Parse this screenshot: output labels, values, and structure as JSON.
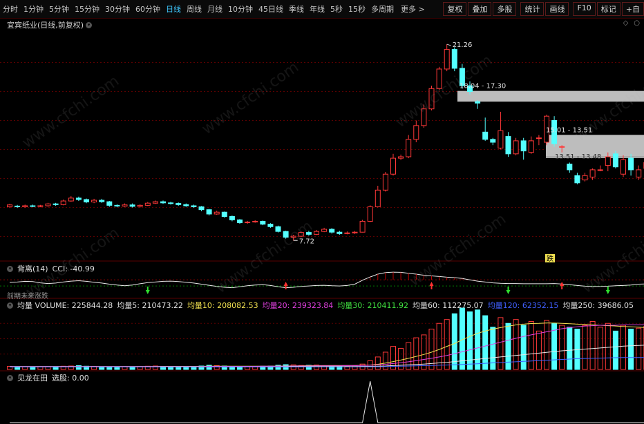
{
  "toolbar": {
    "timeframes": [
      "分时",
      "1分钟",
      "5分钟",
      "15分钟",
      "30分钟",
      "60分钟",
      "日线",
      "周线",
      "月线",
      "10分钟",
      "45日线",
      "季线",
      "年线",
      "5秒",
      "15秒",
      "多周期"
    ],
    "active_timeframe": "日线",
    "more_label": "更多 >",
    "right_buttons": [
      "复权",
      "叠加",
      "多股",
      "统计",
      "画线",
      "F10",
      "标记",
      "+自"
    ]
  },
  "chart_title": "宜宾纸业(日线,前复权)",
  "watermark": "www.cfchi.com",
  "main_annotations": {
    "high_label": "21.26",
    "low_label": "7.72",
    "box1_label": "18.04 - 17.30",
    "box2_label": "15.01 - 13.51",
    "box3_label": "13.51 - 13.48",
    "signal_label": "跌"
  },
  "cci_panel": {
    "name": "背离(14)",
    "value_text": "CCI: -40.99",
    "sublabel": "前期未来涨跌"
  },
  "volume_panel": {
    "items": [
      {
        "text": "均量  VOLUME: 225844.28",
        "color": "#e0e0e0"
      },
      {
        "text": "均量5: 210473.22",
        "color": "#e0e0e0"
      },
      {
        "text": "均量10: 208082.53",
        "color": "#f0e050"
      },
      {
        "text": "均量20: 239323.84",
        "color": "#e040e0"
      },
      {
        "text": "均量30: 210411.92",
        "color": "#40e040"
      },
      {
        "text": "均量60: 112275.07",
        "color": "#e0e0e0"
      },
      {
        "text": "均量120: 62352.15",
        "color": "#4060ff"
      },
      {
        "text": "均量250: 39686.05",
        "color": "#e0e0e0"
      }
    ]
  },
  "signal_panel": {
    "name": "见龙在田",
    "value_text": "选股: 0.00"
  },
  "colors": {
    "up": "#ff3838",
    "down": "#54ffff",
    "grid": "#5a0000",
    "box": "#bdbdbd"
  },
  "chart_data": [
    {
      "type": "candlestick",
      "title": "宜宾纸业(日线,前复权)",
      "ylim": [
        6.5,
        22.5
      ],
      "candles": [
        [
          10.05,
          10.18,
          10.25,
          9.98
        ],
        [
          10.1,
          10.05,
          10.18,
          9.98
        ],
        [
          10.05,
          10.12,
          10.2,
          9.98
        ],
        [
          10.12,
          10.1,
          10.2,
          10.02
        ],
        [
          10.1,
          10.12,
          10.18,
          10.02
        ],
        [
          10.12,
          10.25,
          10.32,
          10.05
        ],
        [
          10.25,
          10.2,
          10.32,
          10.12
        ],
        [
          10.2,
          10.45,
          10.55,
          10.15
        ],
        [
          10.45,
          10.65,
          10.78,
          10.4
        ],
        [
          10.65,
          10.55,
          10.75,
          10.45
        ],
        [
          10.55,
          10.38,
          10.62,
          10.3
        ],
        [
          10.38,
          10.5,
          10.6,
          10.3
        ],
        [
          10.5,
          10.4,
          10.6,
          10.32
        ],
        [
          10.4,
          10.15,
          10.45,
          10.05
        ],
        [
          10.15,
          10.1,
          10.22,
          10.02
        ],
        [
          10.1,
          10.18,
          10.28,
          10.05
        ],
        [
          10.18,
          10.08,
          10.28,
          10.0
        ],
        [
          10.08,
          10.15,
          10.22,
          10.0
        ],
        [
          10.15,
          10.3,
          10.38,
          10.1
        ],
        [
          10.3,
          10.4,
          10.48,
          10.25
        ],
        [
          10.4,
          10.32,
          10.48,
          10.25
        ],
        [
          10.32,
          10.28,
          10.4,
          10.2
        ],
        [
          10.28,
          10.2,
          10.35,
          10.12
        ],
        [
          10.2,
          10.12,
          10.28,
          10.05
        ],
        [
          10.12,
          10.05,
          10.2,
          9.98
        ],
        [
          10.05,
          9.85,
          10.1,
          9.75
        ],
        [
          9.85,
          9.55,
          9.9,
          9.45
        ],
        [
          9.55,
          9.68,
          9.78,
          9.5
        ],
        [
          9.68,
          9.38,
          9.72,
          9.3
        ],
        [
          9.38,
          9.15,
          9.45,
          9.05
        ],
        [
          9.15,
          8.95,
          9.2,
          8.88
        ],
        [
          8.95,
          9.0,
          9.08,
          8.88
        ],
        [
          9.0,
          9.05,
          9.12,
          8.95
        ],
        [
          9.05,
          8.85,
          9.1,
          8.78
        ],
        [
          8.85,
          8.68,
          8.92,
          8.6
        ],
        [
          8.68,
          8.35,
          8.75,
          8.28
        ],
        [
          8.35,
          7.95,
          8.4,
          7.85
        ],
        [
          7.95,
          8.02,
          8.12,
          7.72
        ],
        [
          8.02,
          8.28,
          8.35,
          7.95
        ],
        [
          8.28,
          8.15,
          8.4,
          8.05
        ],
        [
          8.15,
          8.35,
          8.45,
          8.1
        ],
        [
          8.35,
          8.5,
          8.6,
          8.3
        ],
        [
          8.5,
          8.3,
          8.58,
          8.2
        ],
        [
          8.3,
          8.2,
          8.4,
          8.12
        ],
        [
          8.2,
          8.25,
          8.35,
          8.15
        ],
        [
          8.25,
          8.3,
          8.38,
          8.18
        ],
        [
          8.3,
          9.05,
          9.15,
          8.28
        ],
        [
          9.05,
          10.05,
          10.15,
          9.0
        ],
        [
          10.05,
          11.2,
          11.5,
          10.0
        ],
        [
          11.2,
          12.3,
          12.45,
          11.1
        ],
        [
          12.3,
          13.4,
          13.7,
          12.2
        ],
        [
          13.4,
          13.5,
          13.65,
          13.28
        ],
        [
          13.5,
          14.7,
          15.0,
          13.4
        ],
        [
          14.7,
          15.65,
          16.0,
          14.5
        ],
        [
          15.65,
          16.8,
          17.1,
          15.5
        ],
        [
          16.8,
          18.2,
          18.4,
          16.7
        ],
        [
          18.2,
          19.55,
          19.7,
          18.1
        ],
        [
          19.55,
          20.9,
          21.26,
          19.4
        ],
        [
          20.9,
          19.6,
          21.05,
          19.4
        ],
        [
          19.6,
          18.4,
          19.9,
          18.2
        ],
        [
          18.4,
          18.0,
          18.7,
          17.8
        ],
        [
          17.3,
          17.2,
          17.4,
          16.8
        ],
        [
          15.2,
          14.7,
          16.2,
          14.6
        ],
        [
          14.7,
          14.5,
          14.8,
          14.3
        ],
        [
          14.1,
          15.3,
          16.6,
          14.0
        ],
        [
          14.9,
          13.7,
          15.2,
          13.5
        ],
        [
          13.7,
          14.6,
          14.8,
          13.6
        ],
        [
          14.6,
          13.9,
          14.8,
          13.3
        ],
        [
          13.8,
          14.6,
          14.9,
          13.7
        ],
        [
          14.8,
          14.8,
          15.0,
          14.3
        ],
        [
          14.5,
          16.3,
          16.4,
          14.3
        ],
        [
          16.0,
          14.4,
          16.3,
          14.2
        ],
        [
          14.2,
          14.2,
          14.3,
          13.8
        ],
        [
          13.0,
          12.6,
          13.1,
          12.4
        ],
        [
          12.2,
          11.7,
          12.4,
          11.6
        ],
        [
          11.9,
          12.2,
          12.4,
          11.8
        ],
        [
          12.1,
          12.6,
          12.7,
          11.9
        ],
        [
          12.6,
          12.6,
          12.9,
          12.5
        ],
        [
          12.9,
          13.5,
          13.8,
          12.5
        ],
        [
          13.7,
          12.8,
          13.9,
          12.7
        ],
        [
          12.3,
          13.3,
          13.6,
          12.1
        ],
        [
          13.4,
          12.6,
          13.7,
          12.2
        ],
        [
          12.1,
          12.6,
          12.9,
          11.9
        ],
        [
          12.7,
          13.1,
          13.5,
          12.5
        ]
      ],
      "price_boxes": [
        {
          "label": "18.04 - 17.30",
          "top": 18.04,
          "bottom": 17.3
        },
        {
          "label": "15.01 - 13.51",
          "top": 15.01,
          "bottom": 13.51
        },
        {
          "label": "13.51 - 13.48",
          "top": 13.51,
          "bottom": 13.48
        }
      ]
    },
    {
      "type": "line",
      "title": "背离(14)",
      "ylabel": "CCI",
      "last_value": -40.99,
      "series": [
        {
          "name": "CCI",
          "values": [
            0,
            2,
            5,
            4,
            -2,
            -5,
            -3,
            2,
            6,
            8,
            5,
            1,
            -3,
            -8,
            -12,
            -15,
            -12,
            -6,
            -1,
            2,
            5,
            6,
            4,
            1,
            -3,
            -8,
            -13,
            -18,
            -22,
            -24,
            -20,
            -15,
            -12,
            -10,
            -14,
            -20,
            -24,
            -22,
            -18,
            -16,
            -14,
            -13,
            -15,
            -16,
            -14,
            -8,
            10,
            25,
            38,
            45,
            47,
            46,
            42,
            38,
            33,
            30,
            27,
            24,
            22,
            18,
            12,
            6,
            2,
            -2,
            -4,
            -5,
            -5,
            -6,
            -6,
            -6,
            -6,
            -5,
            -7,
            -10,
            -14,
            -17,
            -18,
            -18,
            -17,
            -15,
            -14,
            -12,
            -8,
            -7
          ]
        }
      ],
      "up_arrow_positions": [
        36,
        55,
        72
      ],
      "down_arrow_positions": [
        18,
        65,
        78
      ]
    },
    {
      "type": "bar",
      "title": "均量",
      "series": [
        {
          "name": "VOLUME",
          "values": [
            16,
            15,
            13,
            12,
            13,
            15,
            15,
            17,
            18,
            20,
            17,
            16,
            14,
            14,
            13,
            15,
            14,
            15,
            17,
            18,
            16,
            15,
            14,
            14,
            14,
            18,
            22,
            20,
            18,
            16,
            15,
            16,
            15,
            17,
            18,
            22,
            25,
            24,
            21,
            22,
            23,
            20,
            18,
            17,
            18,
            19,
            28,
            45,
            65,
            90,
            120,
            110,
            140,
            165,
            180,
            210,
            240,
            260,
            290,
            320,
            300,
            310,
            280,
            220,
            270,
            240,
            260,
            230,
            250,
            200,
            255,
            240,
            230,
            220,
            210,
            230,
            250,
            220,
            240,
            200,
            230,
            210,
            215,
            225
          ]
        },
        {
          "name": "均量10",
          "values": [
            15,
            15,
            15,
            15,
            15,
            15,
            15,
            15,
            15,
            15,
            15,
            15,
            15,
            15,
            15,
            15,
            15,
            15,
            15,
            15,
            16,
            16,
            16,
            16,
            16,
            16,
            17,
            17,
            17,
            17,
            17,
            17,
            17,
            17,
            17,
            18,
            18,
            19,
            19,
            20,
            20,
            20,
            21,
            21,
            21,
            21,
            22,
            23,
            27,
            33,
            41,
            49,
            58,
            68,
            78,
            90,
            104,
            120,
            135,
            155,
            172,
            188,
            200,
            210,
            218,
            225,
            232,
            236,
            239,
            240,
            242,
            242,
            240,
            238,
            236,
            234,
            232,
            230,
            228,
            226,
            224,
            222,
            220,
            218
          ]
        },
        {
          "name": "均量20",
          "values": [
            15,
            15,
            15,
            15,
            15,
            15,
            15,
            15,
            15,
            15,
            15,
            15,
            15,
            15,
            15,
            15,
            15,
            15,
            15,
            15,
            15,
            15,
            15,
            15,
            15,
            15,
            16,
            16,
            16,
            16,
            16,
            16,
            16,
            17,
            17,
            17,
            17,
            18,
            18,
            18,
            19,
            19,
            19,
            19,
            20,
            20,
            21,
            22,
            24,
            27,
            31,
            35,
            40,
            46,
            52,
            58,
            65,
            73,
            82,
            92,
            102,
            112,
            122,
            132,
            142,
            152,
            162,
            172,
            180,
            188,
            196,
            204,
            212,
            218,
            222,
            226,
            228,
            230,
            230,
            230,
            232,
            232,
            232,
            233
          ]
        },
        {
          "name": "均量60",
          "values": [
            14,
            14,
            14,
            14,
            14,
            14,
            14,
            14,
            14,
            14,
            14,
            14,
            14,
            14,
            14,
            14,
            14,
            14,
            14,
            14,
            14,
            14,
            14,
            14,
            14,
            14,
            14,
            14,
            14,
            14,
            14,
            14,
            14,
            14,
            14,
            14,
            15,
            15,
            15,
            15,
            15,
            15,
            15,
            15,
            15,
            15,
            16,
            16,
            17,
            18,
            20,
            22,
            24,
            26,
            28,
            31,
            34,
            37,
            41,
            45,
            49,
            53,
            57,
            61,
            65,
            69,
            73,
            77,
            81,
            85,
            89,
            93,
            97,
            100,
            103,
            106,
            109,
            112,
            115,
            118,
            121,
            123,
            125,
            127
          ]
        },
        {
          "name": "均量120",
          "values": [
            13,
            13,
            13,
            13,
            13,
            13,
            13,
            13,
            13,
            13,
            13,
            13,
            13,
            13,
            13,
            13,
            13,
            13,
            13,
            13,
            13,
            13,
            13,
            13,
            13,
            13,
            13,
            13,
            13,
            13,
            13,
            13,
            13,
            13,
            13,
            13,
            13,
            13,
            13,
            13,
            13,
            13,
            13,
            13,
            13,
            13,
            14,
            14,
            14,
            15,
            16,
            17,
            18,
            19,
            20,
            21,
            22,
            23,
            24,
            26,
            28,
            30,
            32,
            34,
            36,
            38,
            40,
            42,
            44,
            46,
            48,
            50,
            52,
            54,
            56,
            57,
            58,
            59,
            60,
            61,
            62,
            62,
            62,
            62
          ]
        }
      ]
    },
    {
      "type": "line",
      "title": "见龙在田",
      "last_value": 0.0,
      "series": [
        {
          "name": "选股",
          "values": [
            0,
            0,
            0,
            0,
            0,
            0,
            0,
            0,
            0,
            0,
            0,
            0,
            0,
            0,
            0,
            0,
            0,
            0,
            0,
            0,
            0,
            0,
            0,
            0,
            0,
            0,
            0,
            0,
            0,
            0,
            0,
            0,
            0,
            0,
            0,
            0,
            0,
            0,
            0,
            0,
            0,
            0,
            0,
            0,
            0,
            0,
            0,
            1,
            0,
            0,
            0,
            0,
            0,
            0,
            0,
            0,
            0,
            0,
            0,
            0,
            0,
            0,
            0,
            0,
            0,
            0,
            0,
            0,
            0,
            0,
            0,
            0,
            0,
            0,
            0,
            0,
            0,
            0,
            0,
            0,
            0,
            0,
            0,
            0
          ]
        }
      ]
    }
  ]
}
